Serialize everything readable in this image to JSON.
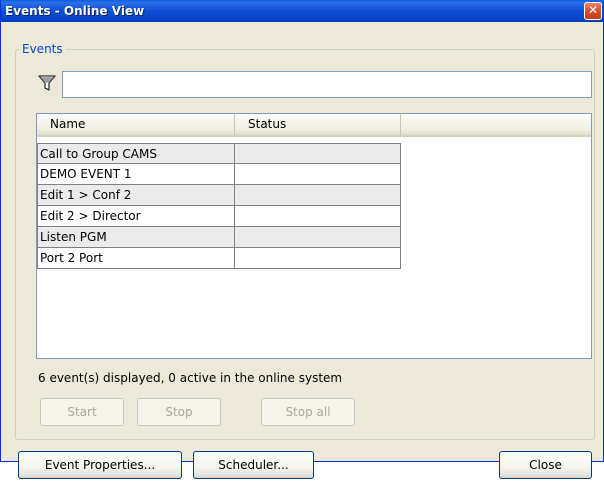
{
  "window": {
    "title": "Events - Online View",
    "close_glyph": "✕"
  },
  "events_group": {
    "legend": "Events",
    "filter_icon": "funnel-filter-icon",
    "filter_value": ""
  },
  "list": {
    "columns": [
      "Name",
      "Status"
    ],
    "rows": [
      {
        "name": "Call to Group CAMS",
        "status": ""
      },
      {
        "name": "DEMO EVENT 1",
        "status": ""
      },
      {
        "name": "Edit 1 > Conf 2",
        "status": ""
      },
      {
        "name": "Edit 2 > Director",
        "status": ""
      },
      {
        "name": "Listen PGM",
        "status": ""
      },
      {
        "name": "Port 2 Port",
        "status": ""
      }
    ]
  },
  "summary_text": "6 event(s) displayed, 0 active in the online system",
  "action_buttons": {
    "start": "Start",
    "stop": "Stop",
    "stop_all": "Stop all"
  },
  "footer_buttons": {
    "event_properties": "Event Properties...",
    "scheduler": "Scheduler...",
    "close": "Close"
  },
  "colors": {
    "title_bar": "#0b4fd2",
    "legend_text": "#0046d5",
    "window_bg": "#ece9d8"
  }
}
